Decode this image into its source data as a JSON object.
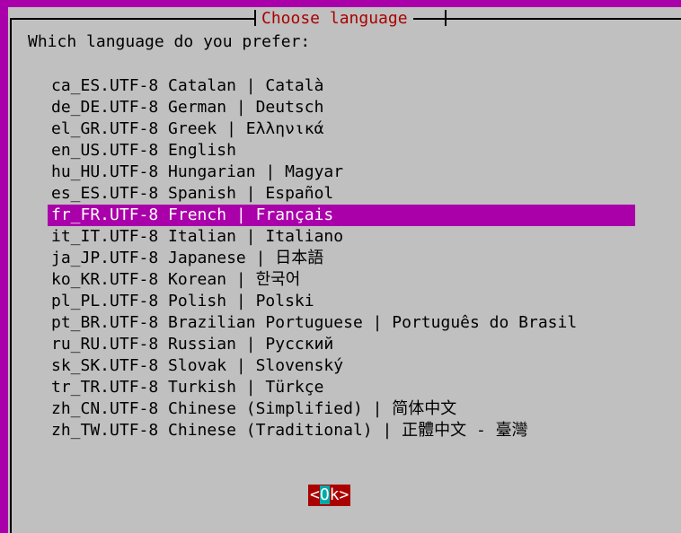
{
  "dialog": {
    "title": "Choose language",
    "prompt": "Which language do you prefer:"
  },
  "languages": [
    "ca_ES.UTF-8 Catalan | Català",
    "de_DE.UTF-8 German | Deutsch",
    "el_GR.UTF-8 Greek | Ελληνικά",
    "en_US.UTF-8 English",
    "hu_HU.UTF-8 Hungarian | Magyar",
    "es_ES.UTF-8 Spanish | Español",
    "fr_FR.UTF-8 French | Français",
    "it_IT.UTF-8 Italian | Italiano",
    "ja_JP.UTF-8 Japanese | 日本語",
    "ko_KR.UTF-8 Korean | 한국어",
    "pl_PL.UTF-8 Polish | Polski",
    "pt_BR.UTF-8 Brazilian Portuguese | Português do Brasil",
    "ru_RU.UTF-8 Russian | Русский",
    "sk_SK.UTF-8 Slovak | Slovenský",
    "tr_TR.UTF-8 Turkish | Türkçe",
    "zh_CN.UTF-8 Chinese (Simplified) | 简体中文",
    "zh_TW.UTF-8 Chinese (Traditional) | 正體中文 - 臺灣"
  ],
  "selected_index": 6,
  "button": {
    "left": "<",
    "hot": "O",
    "rest": "k>"
  },
  "colors": {
    "background": "#aa00aa",
    "dialog": "#c0c0c0",
    "title": "#aa0000",
    "selection": "#aa00aa",
    "button": "#aa0000",
    "button_hotkey": "#00aaaa"
  }
}
